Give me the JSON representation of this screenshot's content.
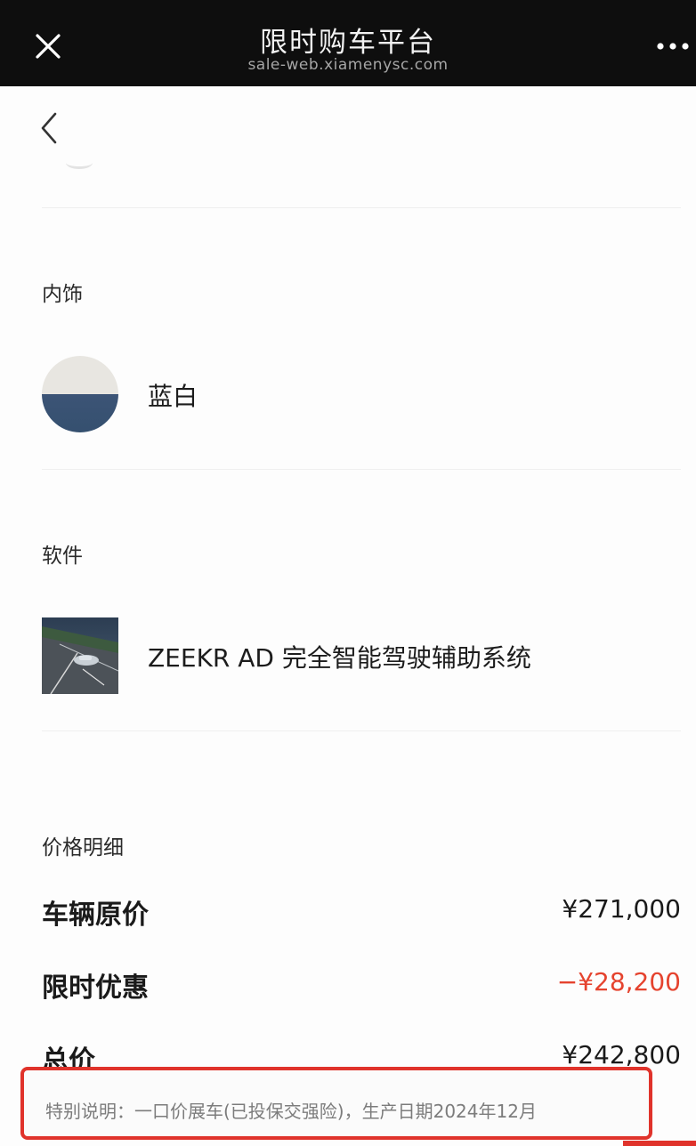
{
  "topbar": {
    "title": "限时购车平台",
    "domain": "sale-web.xiamenysc.com",
    "close_icon": "close-icon",
    "more_icon": "more-horizontal-icon"
  },
  "nav": {
    "back_icon": "chevron-left-icon"
  },
  "interior": {
    "label": "内饰",
    "option_name": "蓝白",
    "swatch_colors": [
      "#e8e6e1",
      "#3c5476"
    ]
  },
  "software": {
    "label": "软件",
    "option_name": "ZEEKR AD 完全智能驾驶辅助系统"
  },
  "price": {
    "label": "价格明细",
    "rows": [
      {
        "label": "车辆原价",
        "value": "¥271,000"
      },
      {
        "label": "限时优惠",
        "value": "−¥28,200"
      },
      {
        "label": "总价",
        "value": "¥242,800"
      }
    ]
  },
  "note": {
    "text": "特别说明：一口价展车(已投保交强险)，生产日期2024年12月"
  },
  "colors": {
    "discount": "#e5432e",
    "highlight_border": "#e0332b",
    "topbar": "#0e0e0e"
  }
}
